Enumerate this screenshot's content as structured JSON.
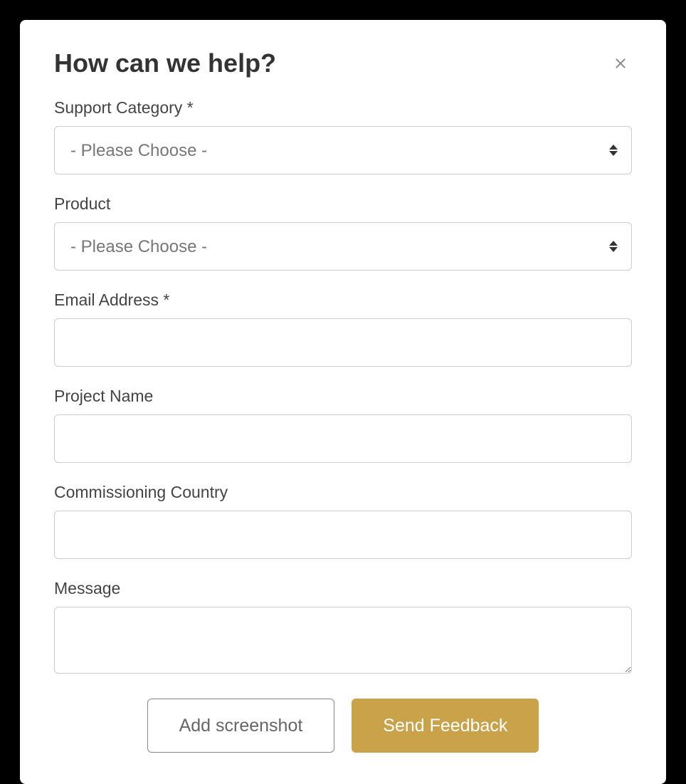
{
  "modal": {
    "title": "How can we help?",
    "fields": {
      "support_category": {
        "label": "Support Category *",
        "selected": "- Please Choose -"
      },
      "product": {
        "label": "Product",
        "selected": "- Please Choose -"
      },
      "email": {
        "label": "Email Address *",
        "value": ""
      },
      "project_name": {
        "label": "Project Name",
        "value": ""
      },
      "country": {
        "label": "Commissioning Country",
        "value": ""
      },
      "message": {
        "label": "Message",
        "value": ""
      }
    },
    "buttons": {
      "screenshot": "Add screenshot",
      "send": "Send Feedback"
    }
  }
}
